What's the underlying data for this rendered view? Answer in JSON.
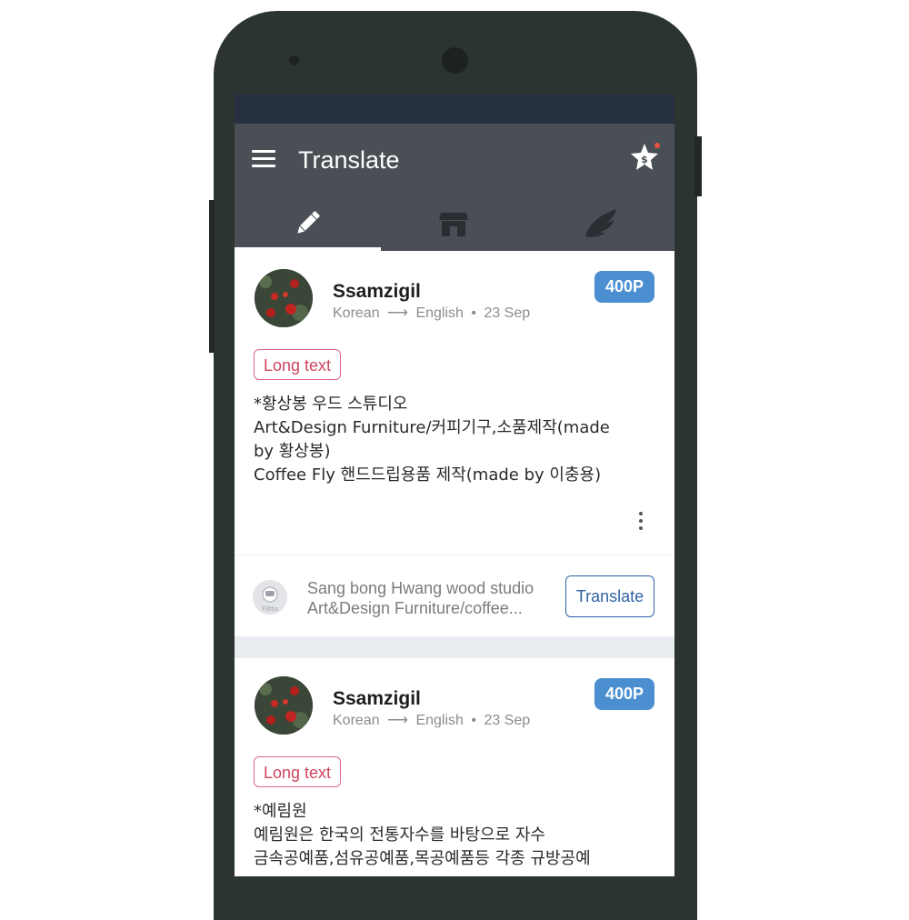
{
  "app": {
    "title": "Translate",
    "accent_color": "#4b8fd0",
    "appbar_color": "#4a4e55",
    "statusbar_color": "#263040"
  },
  "appbar": {
    "menu_icon": "hamburger-menu-icon",
    "reward_icon": "star-dollar-icon",
    "reward_notification_dot_color": "#e8553f"
  },
  "tabs": [
    {
      "icon": "pencil-icon",
      "active": true
    },
    {
      "icon": "store-icon",
      "active": false
    },
    {
      "icon": "wing-icon",
      "active": false
    }
  ],
  "posts": [
    {
      "user": "Ssamzigil",
      "from_lang": "Korean",
      "to_lang": "English",
      "date": "23 Sep",
      "points": "400P",
      "tag": "Long text",
      "lines": [
        "*황상봉 우드 스튜디오",
        "Art&Design Furniture/커피기구,소품제작(made",
        "by 황상봉)",
        "Coffee Fly 핸드드립용품 제작(made by 이충용)"
      ],
      "translation": {
        "line1": "Sang bong Hwang wood studio",
        "line2": "Art&Design Furniture/coffee...",
        "button": "Translate"
      }
    },
    {
      "user": "Ssamzigil",
      "from_lang": "Korean",
      "to_lang": "English",
      "date": "23 Sep",
      "points": "400P",
      "tag": "Long text",
      "lines": [
        "*예림원",
        "예림원은 한국의 전통자수를 바탕으로 자수",
        "금속공예품,섬유공예품,목공예품등 각종 규방공예"
      ]
    }
  ]
}
